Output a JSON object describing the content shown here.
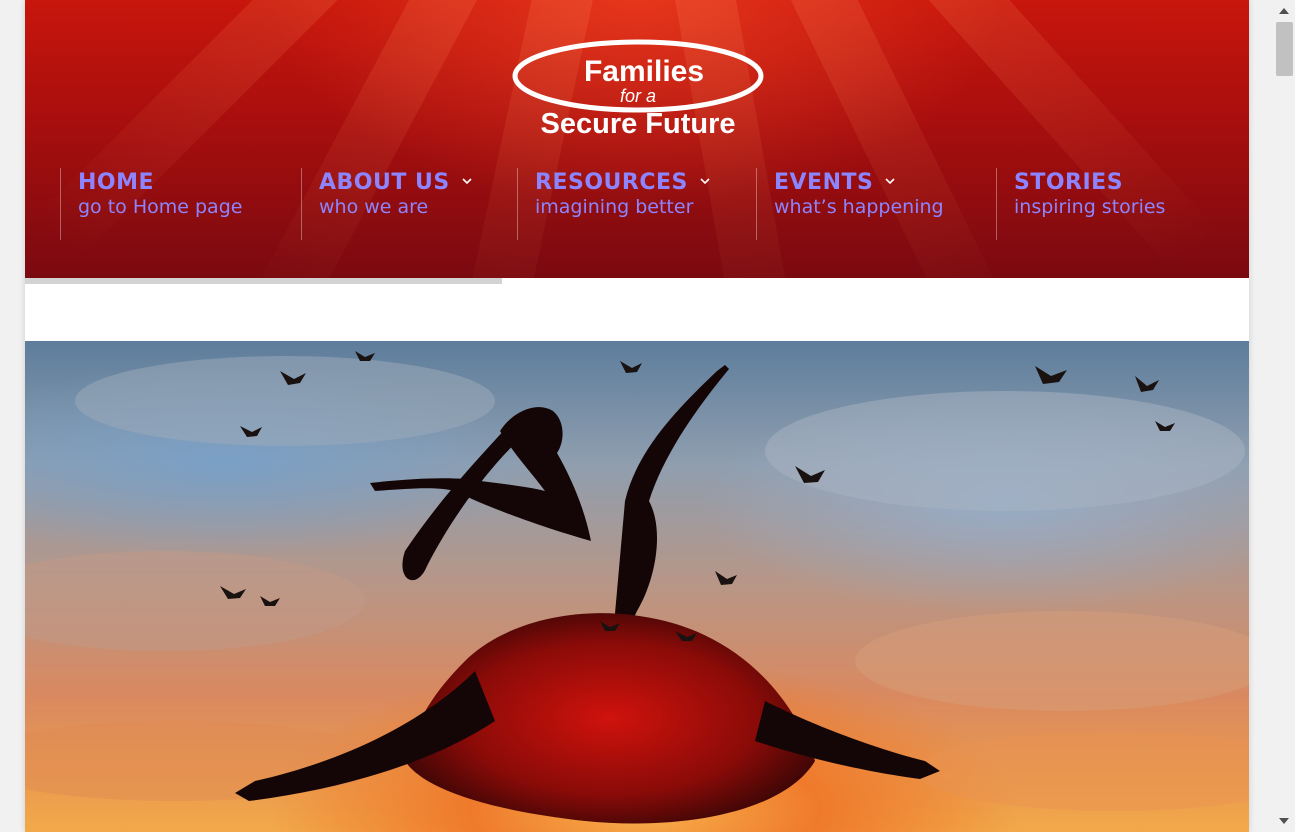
{
  "site": {
    "logo_line1": "Families",
    "logo_line2": "for a",
    "logo_line3": "Secure Future"
  },
  "nav": {
    "items": [
      {
        "title": "HOME",
        "subtitle": "go to Home page",
        "has_dropdown": false
      },
      {
        "title": "ABOUT US",
        "subtitle": "who we are",
        "has_dropdown": true
      },
      {
        "title": "RESOURCES",
        "subtitle": "imagining better",
        "has_dropdown": true
      },
      {
        "title": "EVENTS",
        "subtitle": "what’s happening",
        "has_dropdown": true
      },
      {
        "title": "STORIES",
        "subtitle": "inspiring stories",
        "has_dropdown": false
      }
    ]
  },
  "scroll_progress": 0.39,
  "colors": {
    "header_red": "#b3100e",
    "nav_text": "#8d84ff",
    "progress_bar": "#d3d3d3"
  },
  "hero": {
    "image_subject": "silhouette of a woman in a red dress leaping among birds against a sunset sky"
  },
  "icons": {
    "dropdown": "chevron-down-icon",
    "scroll_up": "scroll-up-arrow-icon",
    "scroll_down": "scroll-down-arrow-icon"
  }
}
